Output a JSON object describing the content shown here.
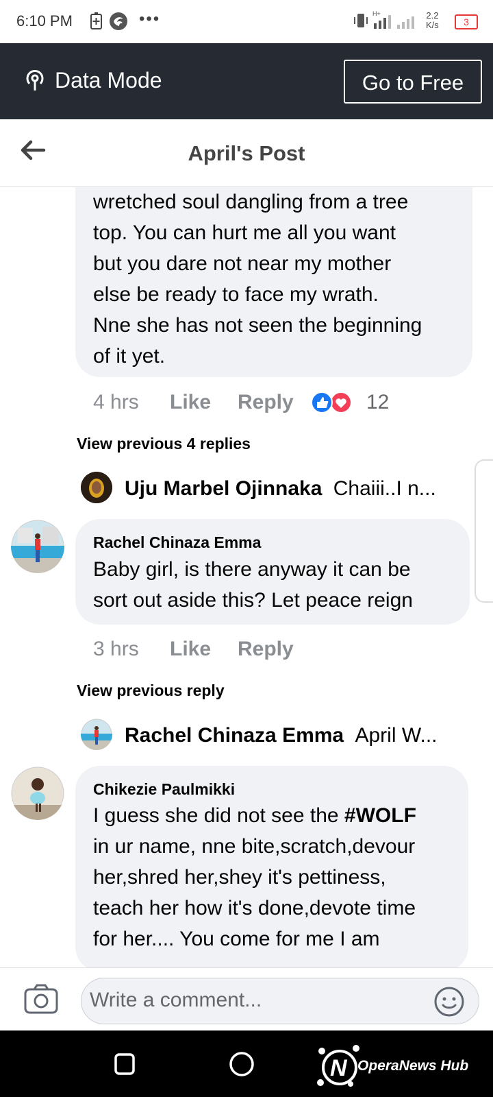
{
  "status_bar": {
    "time": "6:10 PM",
    "overflow": "•••",
    "speed_value": "2.2",
    "speed_unit": "K/s",
    "battery": "3"
  },
  "data_mode": {
    "label": "Data Mode",
    "button": "Go to Free"
  },
  "header": {
    "title": "April's Post"
  },
  "comment1": {
    "lines": [
      "wretched soul dangling from a tree",
      "top. You can hurt me all you want",
      "but you dare not near my mother",
      "else be ready to face my wrath.",
      "Nne she has not seen the beginning",
      "of it yet."
    ],
    "time": "4 hrs",
    "like": "Like",
    "reply": "Reply",
    "reactions": "12"
  },
  "thread1": {
    "view_previous": "View previous 4 replies",
    "reply_name": "Uju Marbel Ojinnaka",
    "reply_preview": "Chaiii..I n..."
  },
  "comment2": {
    "name": "Rachel Chinaza Emma",
    "lines": [
      "Baby girl, is there anyway it can be",
      "sort out aside this?  Let peace reign"
    ],
    "time": "3 hrs",
    "like": "Like",
    "reply": "Reply"
  },
  "thread2": {
    "view_previous": "View previous reply",
    "reply_name": "Rachel Chinaza Emma",
    "reply_preview": "April W..."
  },
  "comment3": {
    "name": "Chikezie Paulmikki",
    "line1_prefix": "I guess she did not see the ",
    "line1_bold": "#WOLF",
    "lines": [
      "in ur name, nne bite,scratch,devour",
      "her,shred her,shey it's pettiness,",
      "teach her how it's done,devote time",
      "for her.... You come for me I am"
    ]
  },
  "composer": {
    "placeholder": "Write a comment..."
  },
  "watermark": "OperaNews Hub"
}
